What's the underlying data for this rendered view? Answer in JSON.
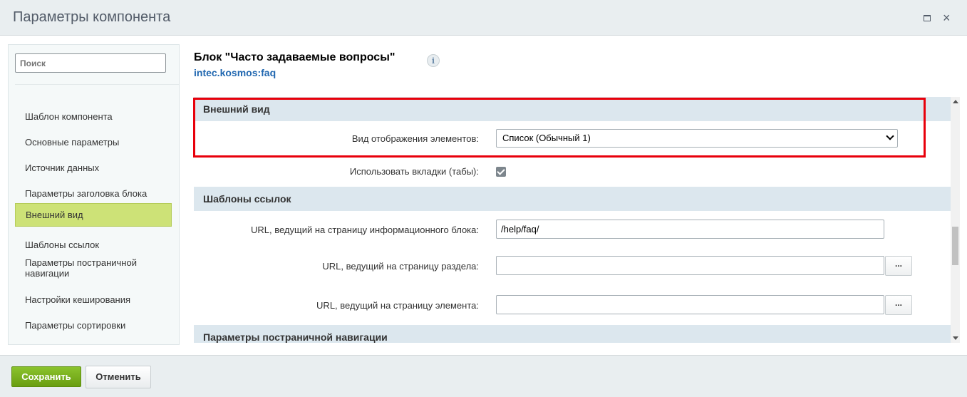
{
  "window": {
    "title": "Параметры компонента",
    "maximize_icon": "maximize-icon",
    "close_label": "×"
  },
  "sidebar": {
    "search_placeholder": "Поиск",
    "items": [
      {
        "label": "Шаблон компонента",
        "active": false
      },
      {
        "label": "Основные параметры",
        "active": false
      },
      {
        "label": "Источник данных",
        "active": false
      },
      {
        "label": "Параметры заголовка блока",
        "active": false
      },
      {
        "label": "Внешний вид",
        "active": true
      },
      {
        "label": "Шаблоны ссылок",
        "active": false
      },
      {
        "label": "Параметры постраничной навигации",
        "active": false
      },
      {
        "label": "Настройки кеширования",
        "active": false
      },
      {
        "label": "Параметры сортировки",
        "active": false
      }
    ]
  },
  "component": {
    "title": "Блок \"Часто задаваемые вопросы\"",
    "info_icon": "i",
    "code": "intec.kosmos:faq"
  },
  "sections": {
    "appearance": {
      "title": "Внешний вид",
      "view_label": "Вид отображения элементов:",
      "view_value": "Список (Обычный 1)",
      "tabs_label": "Использовать вкладки (табы):",
      "tabs_checked": true
    },
    "links": {
      "title": "Шаблоны ссылок",
      "info_url_label": "URL, ведущий на страницу информационного блока:",
      "info_url_value": "/help/faq/",
      "section_url_label": "URL, ведущий на страницу раздела:",
      "section_url_value": "",
      "element_url_label": "URL, ведущий на страницу элемента:",
      "element_url_value": "",
      "browse_label": "..."
    },
    "pagination": {
      "title": "Параметры постраничной навигации"
    }
  },
  "footer": {
    "save_label": "Сохранить",
    "cancel_label": "Отменить"
  },
  "colors": {
    "accent_active": "#cde277",
    "save_button": "#7db21f",
    "highlight": "#e8000b",
    "section_header": "#dce7ee",
    "link": "#2067b0"
  }
}
